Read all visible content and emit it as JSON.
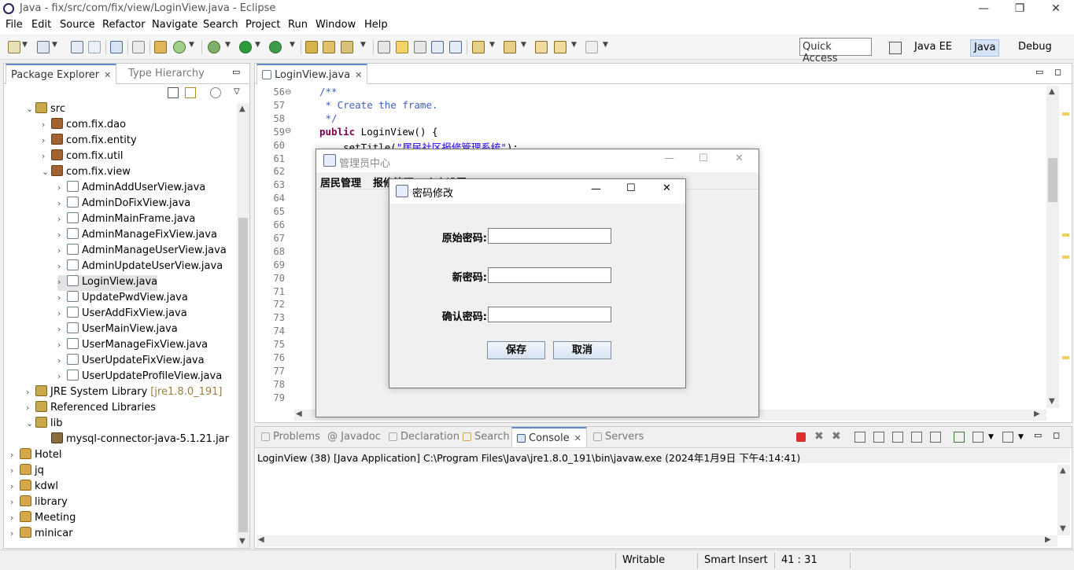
{
  "window": {
    "title": "Java - fix/src/com/fix/view/LoginView.java - Eclipse"
  },
  "menu": [
    "File",
    "Edit",
    "Source",
    "Refactor",
    "Navigate",
    "Search",
    "Project",
    "Run",
    "Window",
    "Help"
  ],
  "toolbar": {
    "quick_access": "Quick Access"
  },
  "perspectives": [
    "Java EE",
    "Java",
    "Debug"
  ],
  "explorer": {
    "tabs": [
      "Package Explorer",
      "Type Hierarchy"
    ],
    "tree": [
      {
        "label": "src",
        "icon": "folder"
      },
      {
        "label": "com.fix.dao",
        "icon": "package"
      },
      {
        "label": "com.fix.entity",
        "icon": "package"
      },
      {
        "label": "com.fix.util",
        "icon": "package"
      },
      {
        "label": "com.fix.view",
        "icon": "package"
      },
      {
        "label": "AdminAddUserView.java",
        "icon": "java"
      },
      {
        "label": "AdminDoFixView.java",
        "icon": "java"
      },
      {
        "label": "AdminMainFrame.java",
        "icon": "java"
      },
      {
        "label": "AdminManageFixView.java",
        "icon": "java"
      },
      {
        "label": "AdminManageUserView.java",
        "icon": "java"
      },
      {
        "label": "AdminUpdateUserView.java",
        "icon": "java"
      },
      {
        "label": "LoginView.java",
        "icon": "java"
      },
      {
        "label": "UpdatePwdView.java",
        "icon": "java"
      },
      {
        "label": "UserAddFixView.java",
        "icon": "java"
      },
      {
        "label": "UserMainView.java",
        "icon": "java"
      },
      {
        "label": "UserManageFixView.java",
        "icon": "java"
      },
      {
        "label": "UserUpdateFixView.java",
        "icon": "java"
      },
      {
        "label": "UserUpdateProfileView.java",
        "icon": "java"
      },
      {
        "label": "JRE System Library",
        "extra": "[jre1.8.0_191]",
        "icon": "library"
      },
      {
        "label": "Referenced Libraries",
        "icon": "library"
      },
      {
        "label": "lib",
        "icon": "folder"
      },
      {
        "label": "mysql-connector-java-5.1.21.jar",
        "icon": "jar"
      },
      {
        "label": "Hotel",
        "icon": "project"
      },
      {
        "label": "jq",
        "icon": "project"
      },
      {
        "label": "kdwl",
        "icon": "project"
      },
      {
        "label": "library",
        "icon": "project"
      },
      {
        "label": "Meeting",
        "icon": "project"
      },
      {
        "label": "minicar",
        "icon": "project"
      }
    ]
  },
  "editor": {
    "tab": "LoginView.java",
    "lines": [
      "56",
      "57",
      "58",
      "59",
      "60",
      "61",
      "62",
      "63",
      "64",
      "65",
      "66",
      "67",
      "68",
      "69",
      "70",
      "71",
      "72",
      "73",
      "74",
      "75",
      "76",
      "77",
      "78",
      "79"
    ],
    "code": {
      "l56": "/**",
      "l57": " * Create the frame.",
      "l58": " */",
      "l59_kw": "public",
      "l59_rest": " LoginView() {",
      "l60_pre": "    setTitle(",
      "l60_str": "\"居民社区报修管理系统\"",
      "l60_post": ");"
    }
  },
  "admin_window": {
    "title": "管理员中心",
    "menus": [
      "居民管理",
      "报修管理",
      "个人设置"
    ]
  },
  "pwd_dialog": {
    "title": "密码修改",
    "old_label": "原始密码:",
    "new_label": "新密码:",
    "confirm_label": "确认密码:",
    "save": "保存",
    "cancel": "取消"
  },
  "bottom": {
    "tabs": [
      "Problems",
      "Javadoc",
      "Declaration",
      "Search",
      "Console",
      "Servers"
    ],
    "console_header": "LoginView (38) [Java Application] C:\\Program Files\\Java\\jre1.8.0_191\\bin\\javaw.exe (2024年1月9日 下午4:14:41)"
  },
  "status": {
    "writable": "Writable",
    "insert": "Smart Insert",
    "position": "41 : 31"
  }
}
